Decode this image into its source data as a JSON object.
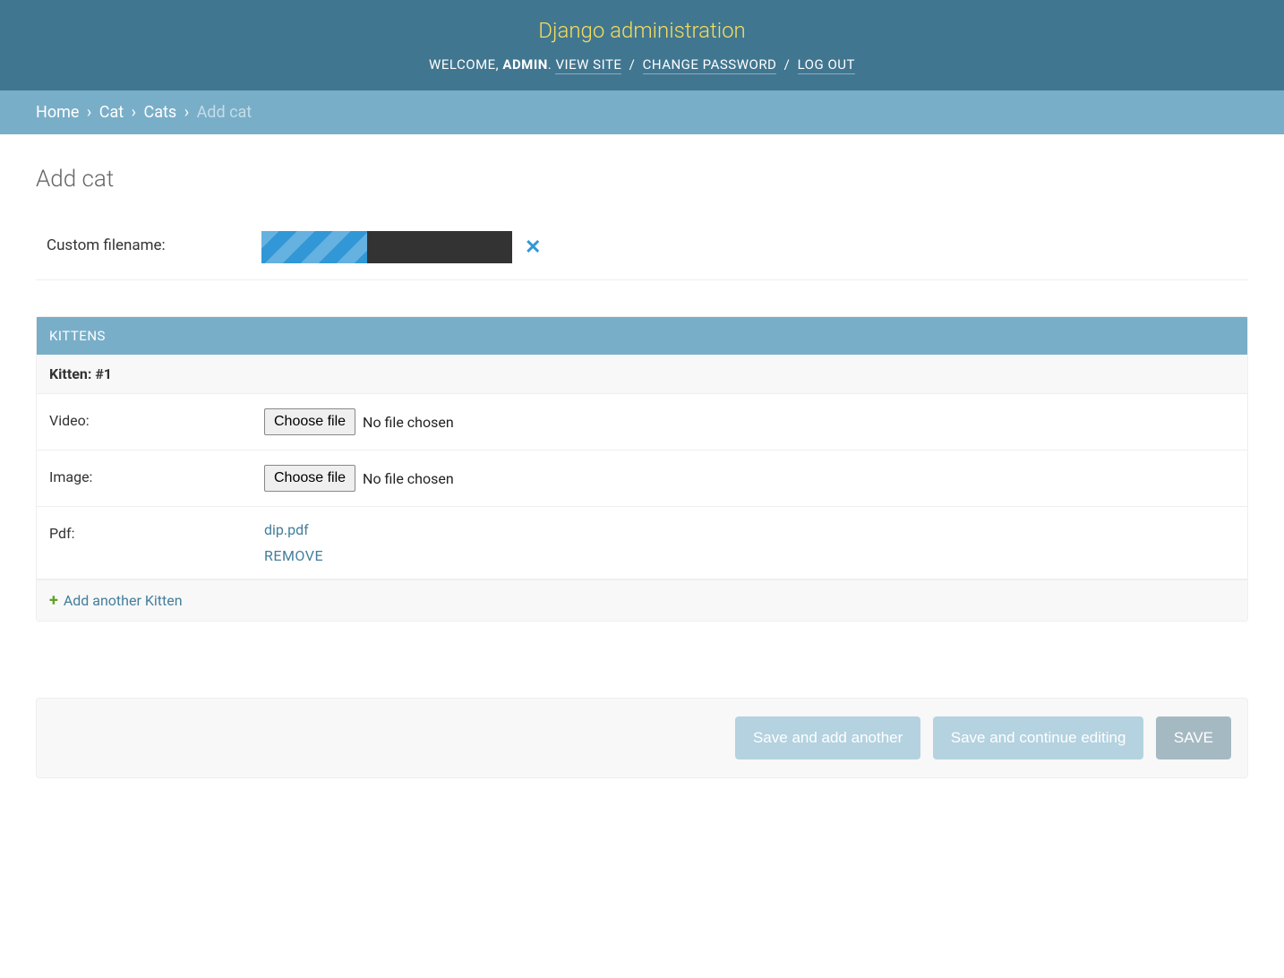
{
  "header": {
    "site_name": "Django administration",
    "welcome": "WELCOME, ",
    "username": "ADMIN",
    "view_site": "VIEW SITE",
    "change_password": "CHANGE PASSWORD",
    "log_out": "LOG OUT"
  },
  "breadcrumbs": {
    "home": "Home",
    "app": "Cat",
    "model": "Cats",
    "current": "Add cat"
  },
  "page_title": "Add cat",
  "fields": {
    "custom_filename_label": "Custom filename:"
  },
  "inline": {
    "group_title": "KITTENS",
    "item_title": "Kitten: #1",
    "video_label": "Video:",
    "image_label": "Image:",
    "pdf_label": "Pdf:",
    "choose_file": "Choose file",
    "no_file": "No file chosen",
    "pdf_filename": "dip.pdf",
    "remove": "REMOVE",
    "add_another": "Add another Kitten"
  },
  "submit": {
    "save_add": "Save and add another",
    "save_continue": "Save and continue editing",
    "save": "SAVE"
  }
}
